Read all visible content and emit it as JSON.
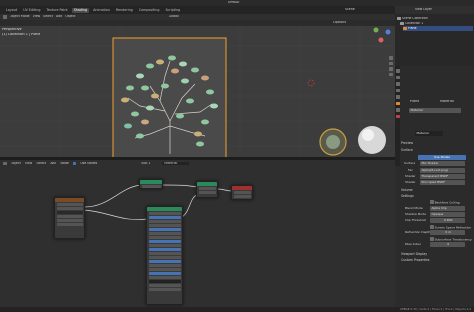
{
  "window": {
    "title": "UPBGE"
  },
  "tabs": [
    {
      "label": "Layout"
    },
    {
      "label": "UV Editing"
    },
    {
      "label": "Texture Paint"
    },
    {
      "label": "Shading",
      "active": true
    },
    {
      "label": "Animation"
    },
    {
      "label": "Rendering"
    },
    {
      "label": "Compositing"
    },
    {
      "label": "Scripting"
    }
  ],
  "scene": {
    "label": "Scene",
    "view_layer": "View Layer"
  },
  "viewport": {
    "mode": "Object Mode",
    "menus": [
      "View",
      "Select",
      "Add",
      "Object"
    ],
    "shading_mode": "Global",
    "overlay_title": "Perspective",
    "overlay_subtitle": "(1) Collection 1 | Plane",
    "options_label": "Options"
  },
  "node_editor": {
    "editor_type": "Object",
    "menus": [
      "View",
      "Select",
      "Add",
      "Node"
    ],
    "use_nodes_label": "Use Nodes",
    "slot_label": "Slot 1",
    "material_label": "Material"
  },
  "outliner": {
    "rows": [
      {
        "label": "Scene Collection",
        "icon": "collection-icon"
      },
      {
        "label": "Collection 1",
        "icon": "collection-icon"
      },
      {
        "label": "Plane",
        "icon": "mesh-icon",
        "selected": true
      }
    ]
  },
  "properties": {
    "object_name": "Plane",
    "material_tab": "Material",
    "material_name": "Material",
    "sections": {
      "preview": "Preview",
      "surface": "Surface",
      "volume": "Volume",
      "settings": "Settings",
      "viewport_display": "Viewport Display",
      "custom_properties": "Custom Properties"
    },
    "use_nodes_label": "Use Nodes",
    "surface_label": "Surface",
    "surface_value": "Mix Shader",
    "fac_label": "Fac",
    "fac_value": "Alpha(8+Lot.png)",
    "shader1_label": "Shader",
    "shader1_value": "Transparent BSDF",
    "shader2_label": "Shader",
    "shader2_value": "Principled BSDF",
    "backface_culling": "Backface Culling",
    "blend_mode_label": "Blend Mode",
    "blend_mode_value": "Alpha Clip",
    "shadow_mode_label": "Shadow Mode",
    "shadow_mode_value": "Opaque",
    "clip_threshold_label": "Clip Threshold",
    "clip_threshold_value": "0.800",
    "screen_space_refraction": "Screen Space Refraction",
    "refraction_depth_label": "Refraction Depth",
    "refraction_depth_value": "0 m",
    "subsurface_translucency": "Subsurface Translucency",
    "pass_index_label": "Pass Index",
    "pass_index_value": "0"
  },
  "status_bar": {
    "version": "UPBGE 0.30 | Verts:4 | Faces:1 | Tris:2 | Objects:1/1"
  }
}
